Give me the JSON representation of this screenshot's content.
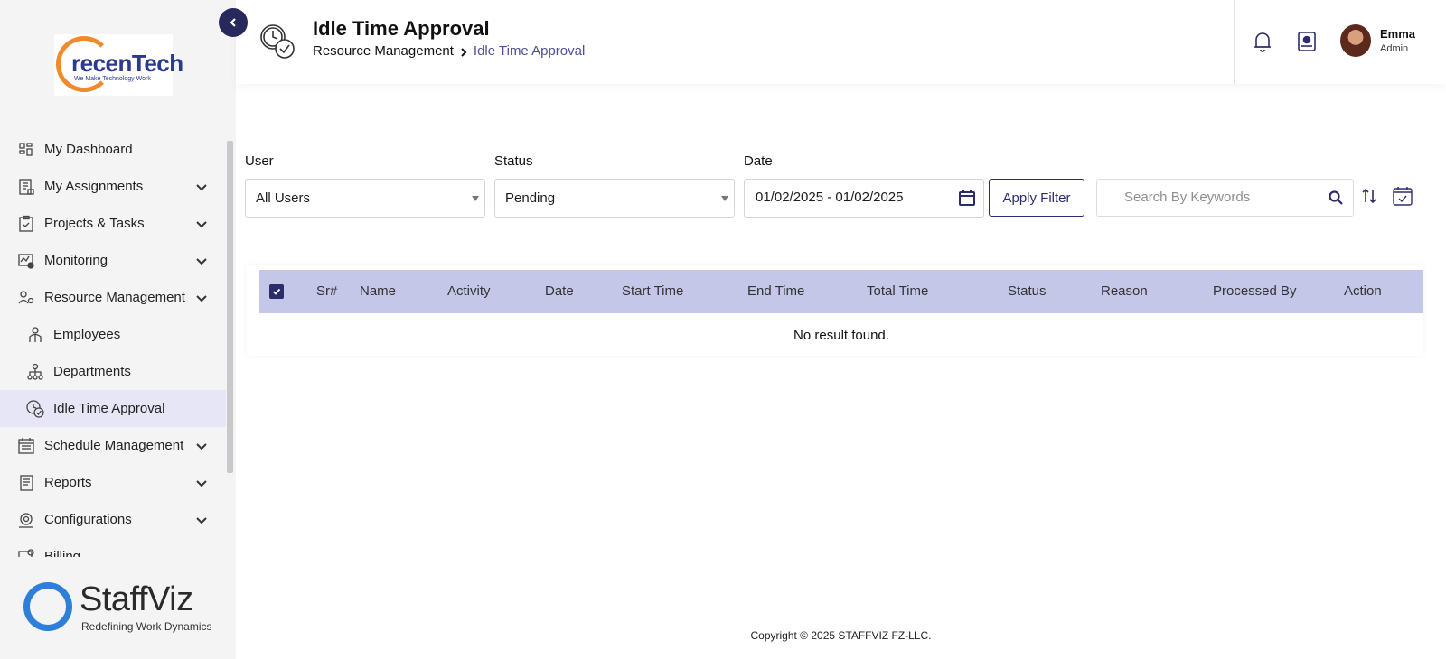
{
  "sidebar": {
    "logo": {
      "brand": "recenTech",
      "tagline": "We Make Technology Work"
    },
    "items": [
      {
        "label": "My Dashboard",
        "icon": "dashboard-icon"
      },
      {
        "label": "My Assignments",
        "icon": "assignments-icon"
      },
      {
        "label": "Projects & Tasks",
        "icon": "clipboard-check-icon"
      },
      {
        "label": "Monitoring",
        "icon": "monitoring-icon"
      },
      {
        "label": "Resource Management",
        "icon": "user-gear-icon"
      },
      {
        "label": "Employees",
        "icon": "employee-icon"
      },
      {
        "label": "Departments",
        "icon": "org-chart-icon"
      },
      {
        "label": "Idle Time Approval",
        "icon": "idle-time-icon"
      },
      {
        "label": "Schedule Management",
        "icon": "schedule-icon"
      },
      {
        "label": "Reports",
        "icon": "report-icon"
      },
      {
        "label": "Configurations",
        "icon": "config-icon"
      },
      {
        "label": "Billing",
        "icon": "billing-icon"
      }
    ],
    "footer_logo": {
      "name": "StaffViz",
      "tagline": "Redefining Work Dynamics"
    }
  },
  "header": {
    "title": "Idle Time Approval",
    "breadcrumb": [
      "Resource Management",
      "Idle Time Approval"
    ],
    "user": {
      "name": "Emma",
      "role": "Admin"
    }
  },
  "filters": {
    "user_label": "User",
    "user_value": "All Users",
    "status_label": "Status",
    "status_value": "Pending",
    "date_label": "Date",
    "date_value": "01/02/2025 - 01/02/2025",
    "apply_label": "Apply Filter",
    "search_placeholder": "Search By Keywords"
  },
  "table": {
    "columns": [
      "Sr#",
      "Name",
      "Activity",
      "Date",
      "Start Time",
      "End Time",
      "Total Time",
      "Status",
      "Reason",
      "Processed By",
      "Action"
    ],
    "empty_text": "No result found."
  },
  "footer": {
    "copyright": "Copyright © 2025 STAFFVIZ FZ-LLC."
  },
  "colors": {
    "primary": "#2b2d6a",
    "table_header": "#c5c7e9",
    "active_nav": "#e6e6f7",
    "sidebar_bg": "#f4f4f5"
  }
}
